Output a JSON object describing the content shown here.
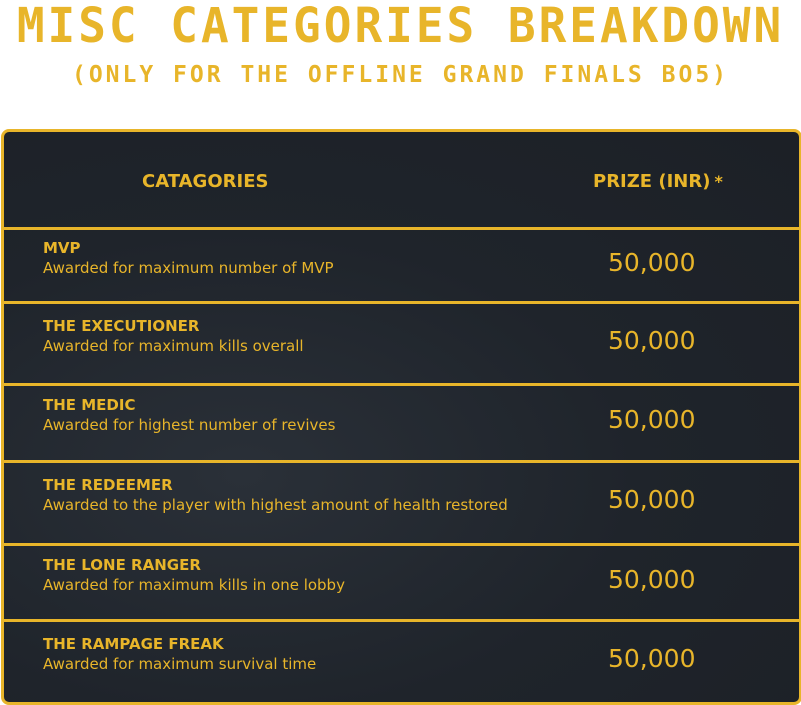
{
  "title": "MISC CATEGORIES BREAKDOWN",
  "subtitle": "(ONLY FOR THE OFFLINE GRAND FINALS BO5)",
  "table": {
    "header": {
      "category": "CATAGORIES",
      "prize": "PRIZE (INR)",
      "asterisk": "*"
    },
    "rows": [
      {
        "name": "MVP",
        "desc": "Awarded for maximum number of MVP",
        "prize": "50,000"
      },
      {
        "name": "THE EXECUTIONER",
        "desc": "Awarded for maximum kills overall",
        "prize": "50,000"
      },
      {
        "name": "THE MEDIC",
        "desc": "Awarded for highest number of revives",
        "prize": "50,000"
      },
      {
        "name": "THE REDEEMER",
        "desc": "Awarded to the player with highest amount of health restored",
        "prize": "50,000"
      },
      {
        "name": "THE LONE RANGER",
        "desc": "Awarded for maximum kills in one lobby",
        "prize": "50,000"
      },
      {
        "name": "THE RAMPAGE FREAK",
        "desc": "Awarded for maximum survival time",
        "prize": "50,000"
      }
    ]
  }
}
